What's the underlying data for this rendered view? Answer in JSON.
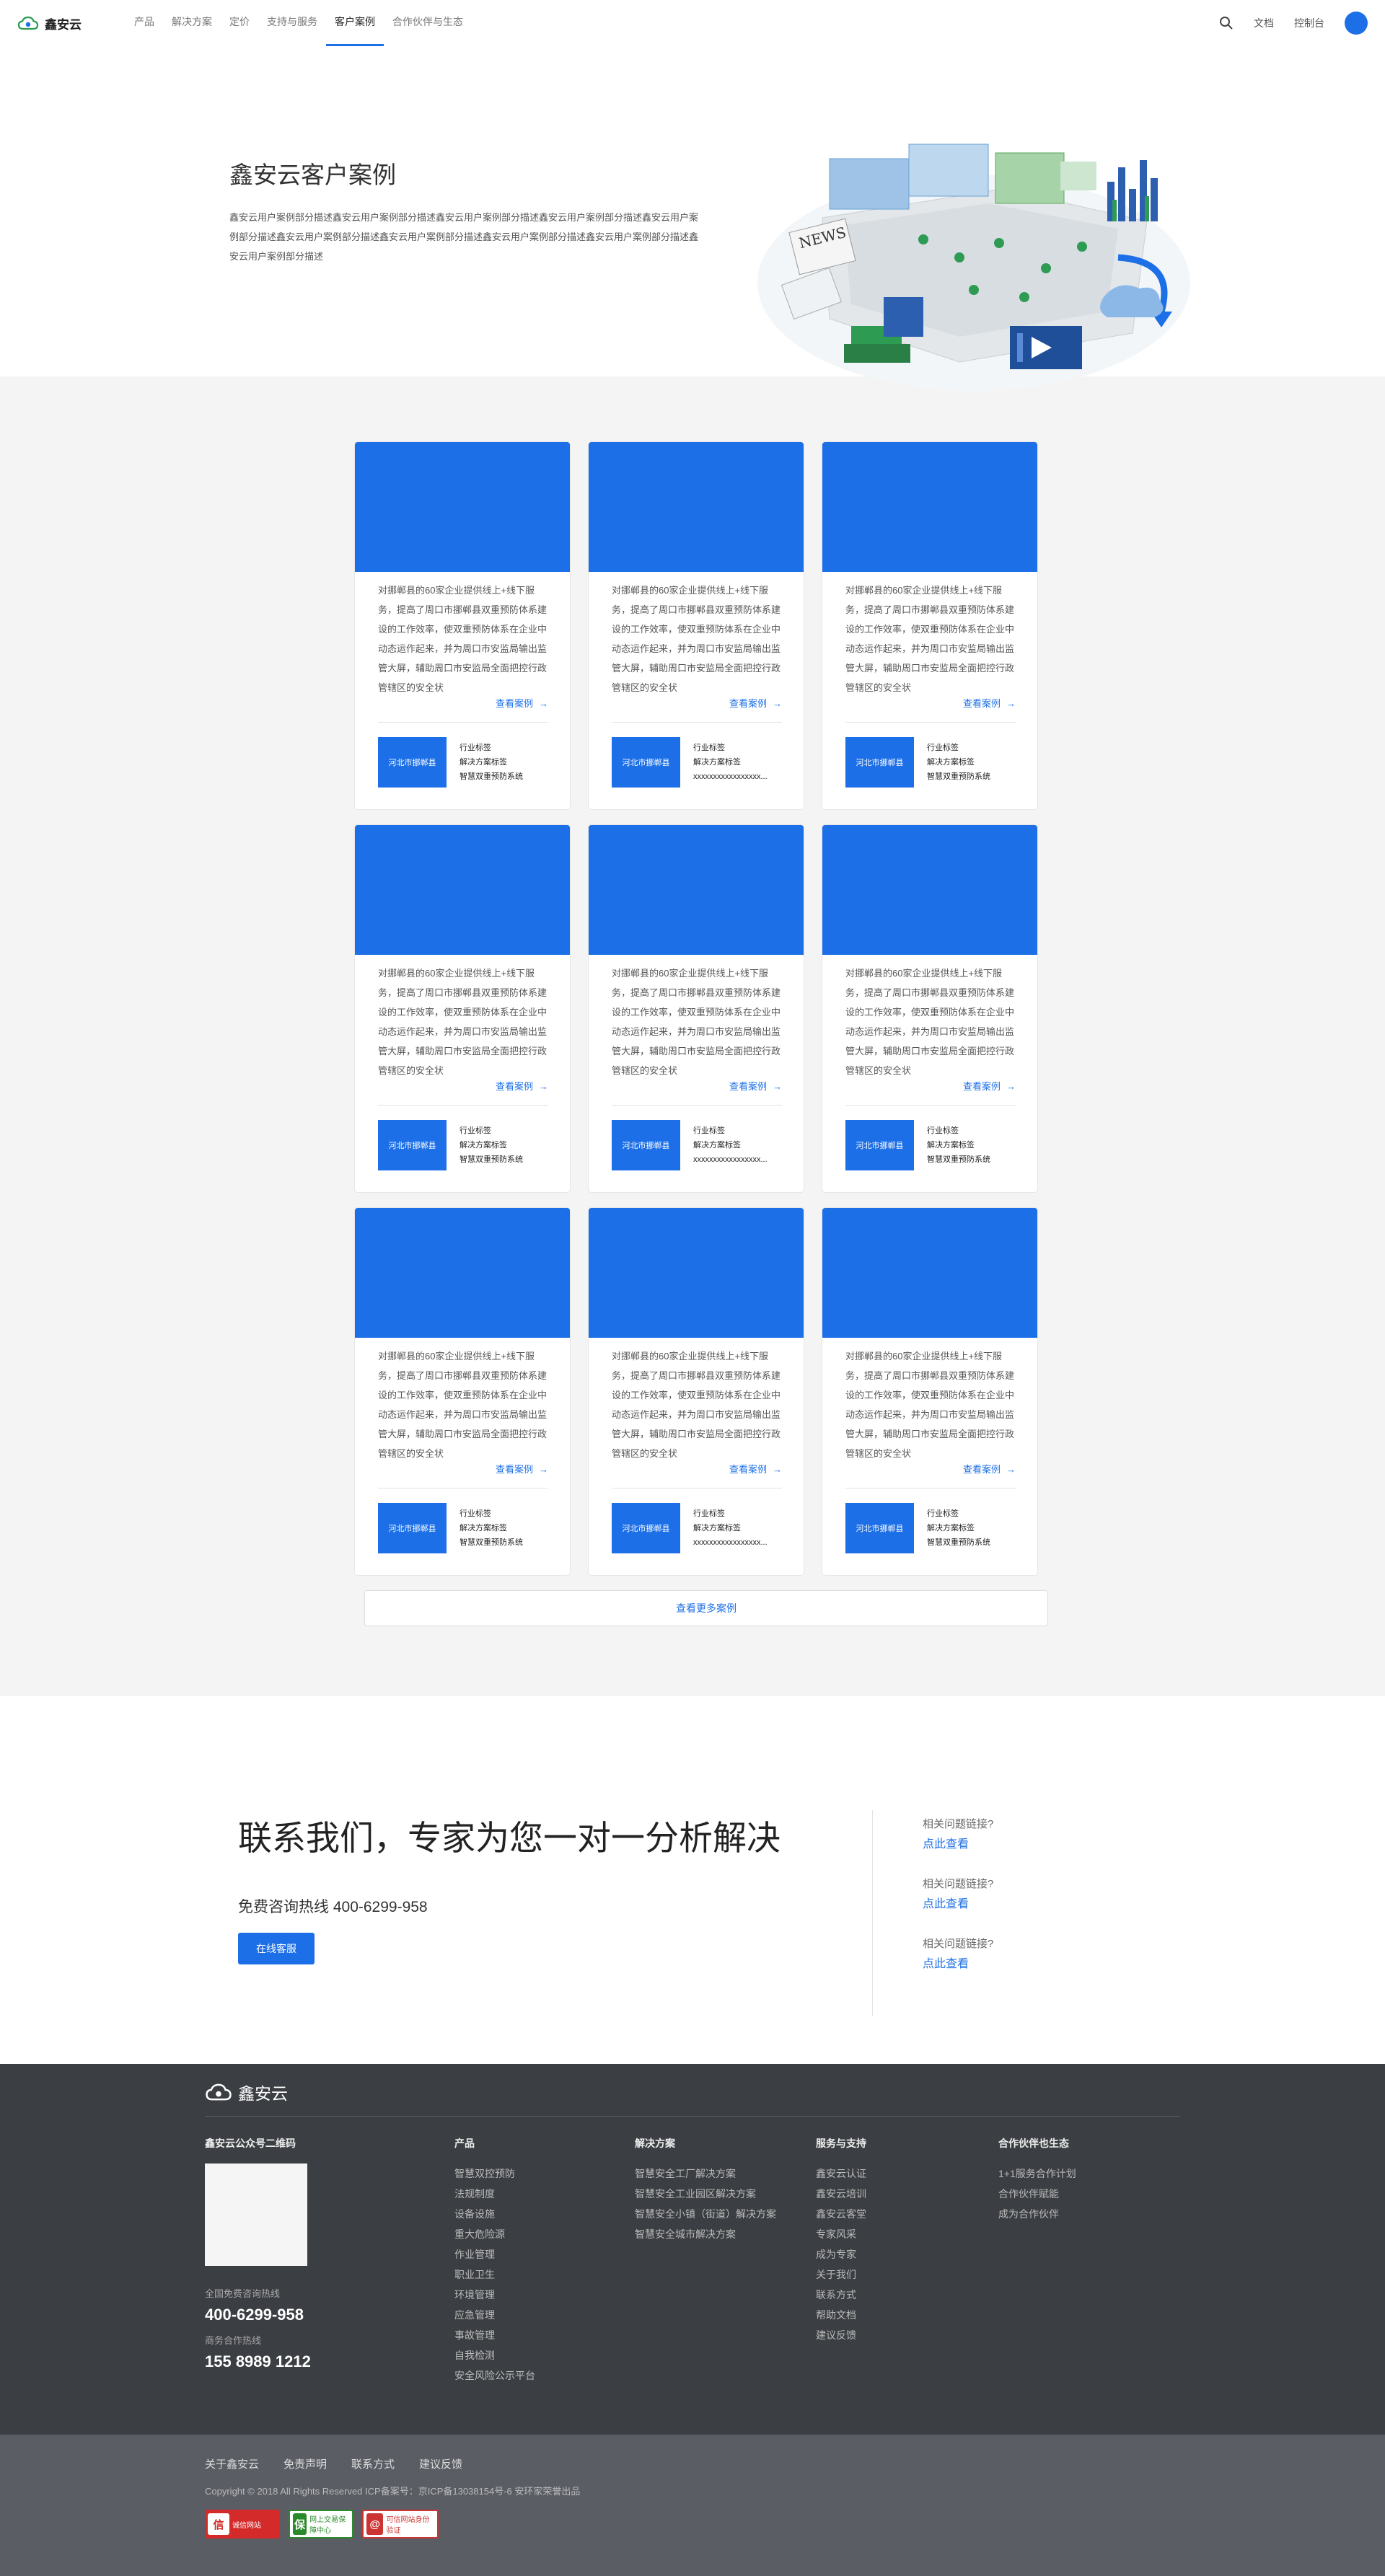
{
  "nav": {
    "logo_text": "鑫安云",
    "items": [
      "产品",
      "解决方案",
      "定价",
      "支持与服务",
      "客户案例",
      "合作伙伴与生态"
    ],
    "docs": "文档",
    "console": "控制台"
  },
  "hero": {
    "title": "鑫安云客户案例",
    "desc": "鑫安云用户案例部分描述鑫安云用户案例部分描述鑫安云用户案例部分描述鑫安云用户案例部分描述鑫安云用户案例部分描述鑫安云用户案例部分描述鑫安云用户案例部分描述鑫安云用户案例部分描述鑫安云用户案例部分描述鑫安云用户案例部分描述"
  },
  "cases": {
    "items": [
      {
        "desc": "对挪郸县的60家企业提供线上+线下服务，提高了周口市挪郸县双重预防体系建设的工作效率，使双重预防体系在企业中动态运作起来，并为周口市安监局输出监管大屏，辅助周口市安监局全面把控行政管辖区的安全状",
        "more": "查看案例",
        "badge": "河北市挪郸县",
        "tag1": "行业标签",
        "tag2": "解决方案标签",
        "tag3": "智慧双重预防系统"
      },
      {
        "desc": "对挪郸县的60家企业提供线上+线下服务，提高了周口市挪郸县双重预防体系建设的工作效率，使双重预防体系在企业中动态运作起来，并为周口市安监局输出监管大屏，辅助周口市安监局全面把控行政管辖区的安全状",
        "more": "查看案例",
        "badge": "河北市挪郸县",
        "tag1": "行业标签",
        "tag2": "解决方案标签",
        "tag3": "xxxxxxxxxxxxxxxxx..."
      },
      {
        "desc": "对挪郸县的60家企业提供线上+线下服务，提高了周口市挪郸县双重预防体系建设的工作效率，使双重预防体系在企业中动态运作起来，并为周口市安监局输出监管大屏，辅助周口市安监局全面把控行政管辖区的安全状",
        "more": "查看案例",
        "badge": "河北市挪郸县",
        "tag1": "行业标签",
        "tag2": "解决方案标签",
        "tag3": "智慧双重预防系统"
      },
      {
        "desc": "对挪郸县的60家企业提供线上+线下服务，提高了周口市挪郸县双重预防体系建设的工作效率，使双重预防体系在企业中动态运作起来，并为周口市安监局输出监管大屏，辅助周口市安监局全面把控行政管辖区的安全状",
        "more": "查看案例",
        "badge": "河北市挪郸县",
        "tag1": "行业标签",
        "tag2": "解决方案标签",
        "tag3": "智慧双重预防系统"
      },
      {
        "desc": "对挪郸县的60家企业提供线上+线下服务，提高了周口市挪郸县双重预防体系建设的工作效率，使双重预防体系在企业中动态运作起来，并为周口市安监局输出监管大屏，辅助周口市安监局全面把控行政管辖区的安全状",
        "more": "查看案例",
        "badge": "河北市挪郸县",
        "tag1": "行业标签",
        "tag2": "解决方案标签",
        "tag3": "xxxxxxxxxxxxxxxxx..."
      },
      {
        "desc": "对挪郸县的60家企业提供线上+线下服务，提高了周口市挪郸县双重预防体系建设的工作效率，使双重预防体系在企业中动态运作起来，并为周口市安监局输出监管大屏，辅助周口市安监局全面把控行政管辖区的安全状",
        "more": "查看案例",
        "badge": "河北市挪郸县",
        "tag1": "行业标签",
        "tag2": "解决方案标签",
        "tag3": "智慧双重预防系统"
      },
      {
        "desc": "对挪郸县的60家企业提供线上+线下服务，提高了周口市挪郸县双重预防体系建设的工作效率，使双重预防体系在企业中动态运作起来，并为周口市安监局输出监管大屏，辅助周口市安监局全面把控行政管辖区的安全状",
        "more": "查看案例",
        "badge": "河北市挪郸县",
        "tag1": "行业标签",
        "tag2": "解决方案标签",
        "tag3": "智慧双重预防系统"
      },
      {
        "desc": "对挪郸县的60家企业提供线上+线下服务，提高了周口市挪郸县双重预防体系建设的工作效率，使双重预防体系在企业中动态运作起来，并为周口市安监局输出监管大屏，辅助周口市安监局全面把控行政管辖区的安全状",
        "more": "查看案例",
        "badge": "河北市挪郸县",
        "tag1": "行业标签",
        "tag2": "解决方案标签",
        "tag3": "xxxxxxxxxxxxxxxxx..."
      },
      {
        "desc": "对挪郸县的60家企业提供线上+线下服务，提高了周口市挪郸县双重预防体系建设的工作效率，使双重预防体系在企业中动态运作起来，并为周口市安监局输出监管大屏，辅助周口市安监局全面把控行政管辖区的安全状",
        "more": "查看案例",
        "badge": "河北市挪郸县",
        "tag1": "行业标签",
        "tag2": "解决方案标签",
        "tag3": "智慧双重预防系统"
      }
    ],
    "load_more": "查看更多案例"
  },
  "contact": {
    "title": "联系我们，专家为您一对一分析解决",
    "hotline": "免费咨询热线 400-6299-958",
    "button": "在线客服",
    "related": [
      {
        "q": "相关问题链接?",
        "a": "点此查看"
      },
      {
        "q": "相关问题链接?",
        "a": "点此查看"
      },
      {
        "q": "相关问题链接?",
        "a": "点此查看"
      }
    ]
  },
  "footer": {
    "logo_text": "鑫安云",
    "qr_title": "鑫安云公众号二维码",
    "hotline_label": "全国免费咨询热线",
    "hotline": "400-6299-958",
    "biz_label": "商务合作热线",
    "biz": "155 8989 1212",
    "columns": [
      {
        "title": "产品",
        "links": [
          "智慧双控预防",
          "法规制度",
          "设备设施",
          "重大危险源",
          "作业管理",
          "职业卫生",
          "环境管理",
          "应急管理",
          "事故管理",
          "自我检测",
          "安全风险公示平台"
        ]
      },
      {
        "title": "解决方案",
        "links": [
          "智慧安全工厂解决方案",
          "智慧安全工业园区解决方案",
          "智慧安全小镇（街道）解决方案",
          "智慧安全城市解决方案"
        ]
      },
      {
        "title": "服务与支持",
        "links": [
          "鑫安云认证",
          "鑫安云培训",
          "鑫安云客堂",
          "专家风采",
          "成为专家",
          "关于我们",
          "联系方式",
          "帮助文档",
          "建议反馈"
        ]
      },
      {
        "title": "合作伙伴也生态",
        "links": [
          "1+1服务合作计划",
          "合作伙伴赋能",
          "成为合作伙伴"
        ]
      }
    ]
  },
  "bottom": {
    "links": [
      "关于鑫安云",
      "免责声明",
      "联系方式",
      "建议反馈"
    ],
    "copyright": "Copyright © 2018  All Rights Reserved   ICP备案号：京ICP备13038154号-6   安环家荣誉出品",
    "badges": [
      {
        "icon": "信",
        "text": "诚信网站"
      },
      {
        "icon": "保",
        "text": "网上交易保障中心"
      },
      {
        "icon": "@",
        "text": "可信网站身份验证"
      }
    ]
  }
}
